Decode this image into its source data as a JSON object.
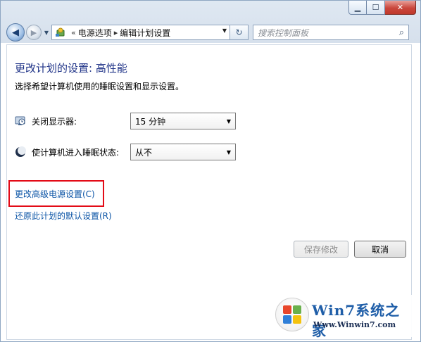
{
  "window": {
    "minimize_glyph": "▁",
    "maximize_glyph": "☐",
    "close_glyph": "✕"
  },
  "nav": {
    "back_glyph": "◀",
    "forward_glyph": "▶",
    "dropdown_glyph": "▼",
    "address": {
      "chevron_lead": "«",
      "crumbs": [
        "电源选项",
        "编辑计划设置"
      ],
      "separator": "▸",
      "icon": "control-panel-icon"
    },
    "refresh_glyph": "↻",
    "search": {
      "placeholder": "搜索控制面板",
      "icon_glyph": "⌕"
    }
  },
  "page": {
    "title": "更改计划的设置: 高性能",
    "subtitle": "选择希望计算机使用的睡眠设置和显示设置。",
    "settings": [
      {
        "label": "关闭显示器:",
        "value": "15 分钟",
        "icon": "monitor-clock-icon"
      },
      {
        "label": "使计算机进入睡眠状态:",
        "value": "从不",
        "icon": "moon-icon"
      }
    ],
    "links": {
      "advanced": "更改高级电源设置(C)",
      "restore": "还原此计划的默认设置(R)"
    },
    "buttons": {
      "save": "保存修改",
      "cancel": "取消"
    }
  },
  "watermark": {
    "brand": "Win7系统之家",
    "url": "Www.Winwin7.com"
  },
  "colors": {
    "title": "#1e3287",
    "link": "#0b54a6",
    "highlight": "#e30b17"
  }
}
